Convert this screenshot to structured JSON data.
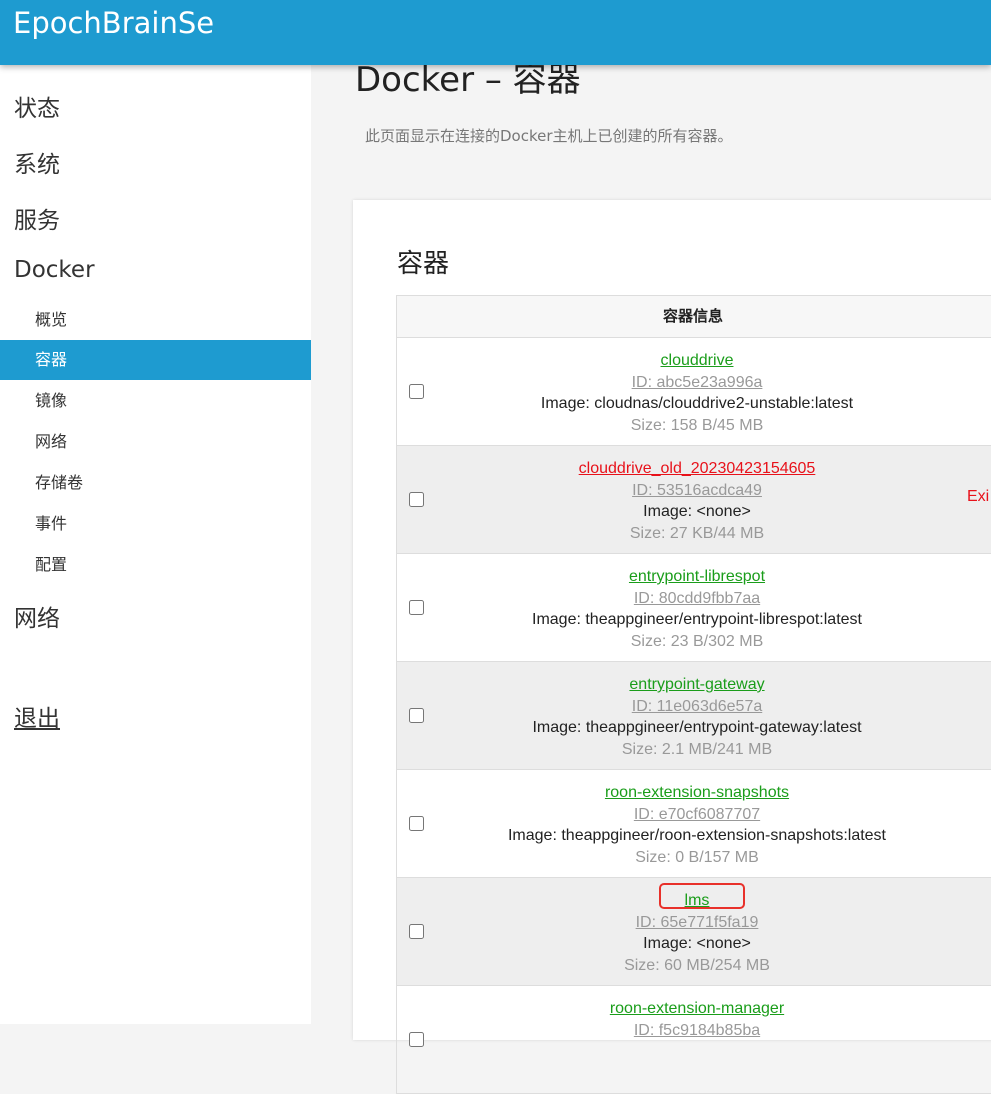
{
  "header": {
    "brand": "EpochBrainSe"
  },
  "sidebar": {
    "status": "状态",
    "system": "系统",
    "services": "服务",
    "docker": "Docker",
    "docker_items": [
      "概览",
      "容器",
      "镜像",
      "网络",
      "存储卷",
      "事件",
      "配置"
    ],
    "network": "网络",
    "logout": "退出"
  },
  "page": {
    "title": "Docker – 容器",
    "description": "此页面显示在连接的Docker主机上已创建的所有容器。"
  },
  "panel": {
    "title": "容器",
    "column_header": "容器信息"
  },
  "containers": [
    {
      "name": "clouddrive",
      "id": "ID: abc5e23a996a",
      "image": "Image: cloudnas/clouddrive2-unstable:latest",
      "size": "Size: 158 B/45 MB",
      "status": ""
    },
    {
      "name": "clouddrive_old_20230423154605",
      "id": "ID: 53516acdca49",
      "image": "Image: <none>",
      "size": "Size: 27 KB/44 MB",
      "status": "Exi"
    },
    {
      "name": "entrypoint-librespot",
      "id": "ID: 80cdd9fbb7aa",
      "image": "Image: theappgineer/entrypoint-librespot:latest",
      "size": "Size: 23 B/302 MB",
      "status": ""
    },
    {
      "name": "entrypoint-gateway",
      "id": "ID: 11e063d6e57a",
      "image": "Image: theappgineer/entrypoint-gateway:latest",
      "size": "Size: 2.1 MB/241 MB",
      "status": ""
    },
    {
      "name": "roon-extension-snapshots",
      "id": "ID: e70cf6087707",
      "image": "Image: theappgineer/roon-extension-snapshots:latest",
      "size": "Size: 0 B/157 MB",
      "status": ""
    },
    {
      "name": "lms",
      "id": "ID: 65e771f5fa19",
      "image": "Image: <none>",
      "size": "Size: 60 MB/254 MB",
      "status": ""
    },
    {
      "name": "roon-extension-manager",
      "id": "ID: f5c9184b85ba",
      "image": "",
      "size": "",
      "status": ""
    }
  ],
  "colors": {
    "header": "#1e9bd0",
    "running_link": "#1a9d1a",
    "stopped_link": "#e8111a",
    "highlight_box": "#e8302a"
  }
}
